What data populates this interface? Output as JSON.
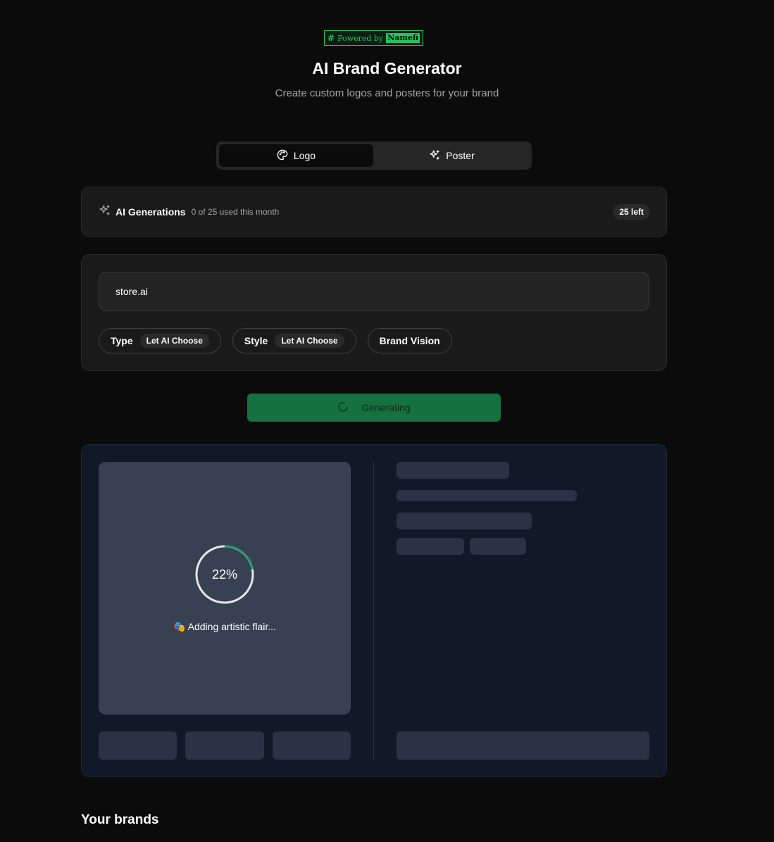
{
  "badge": {
    "prefix": "Powered by",
    "brand": "Namefi",
    "icon": "hash-icon",
    "accent": "#22c55e"
  },
  "header": {
    "title": "AI Brand Generator",
    "subtitle": "Create custom logos and posters for your brand"
  },
  "tabs": [
    {
      "label": "Logo",
      "icon": "palette-icon",
      "active": true
    },
    {
      "label": "Poster",
      "icon": "sparkles-icon",
      "active": false
    }
  ],
  "generations": {
    "icon": "sparkles-icon",
    "title": "AI Generations",
    "usage": "0 of 25 used this month",
    "remaining": "25 left"
  },
  "form": {
    "brand_value": "store.ai",
    "chips": {
      "type_label": "Type",
      "type_value": "Let AI Choose",
      "style_label": "Style",
      "style_value": "Let AI Choose",
      "vision_label": "Brand Vision"
    }
  },
  "generate_button": {
    "label": "Generating",
    "icon": "spinner-icon",
    "color": "#15713f"
  },
  "progress": {
    "percent_text": "22%",
    "fraction": 0.22,
    "emoji": "🎭",
    "status": "Adding artistic flair...",
    "accent": "#22a06b"
  },
  "brands_section": {
    "title": "Your brands"
  }
}
